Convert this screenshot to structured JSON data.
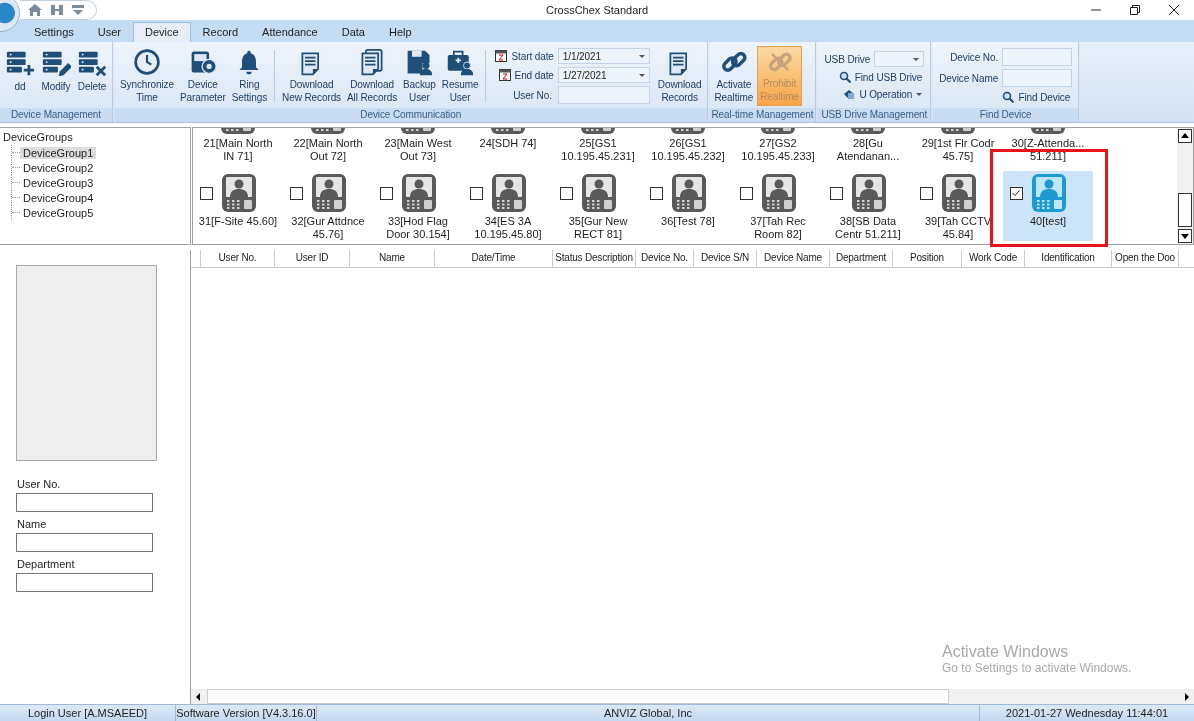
{
  "window": {
    "title": "CrossChex Standard"
  },
  "menu_tabs": [
    {
      "label": "Settings",
      "selected": false
    },
    {
      "label": "User",
      "selected": false
    },
    {
      "label": "Device",
      "selected": true
    },
    {
      "label": "Record",
      "selected": false
    },
    {
      "label": "Attendance",
      "selected": false
    },
    {
      "label": "Data",
      "selected": false
    },
    {
      "label": "Help",
      "selected": false
    }
  ],
  "device_management": {
    "title": "Device Management",
    "buttons": [
      {
        "label": "dd"
      },
      {
        "label": "Modify"
      },
      {
        "label": "Delete"
      }
    ]
  },
  "device_communication": {
    "title": "Device Communication",
    "buttons_a": [
      {
        "label": "Synchronize\nTime"
      },
      {
        "label": "Device\nParameter"
      },
      {
        "label": "Ring\nSettings"
      }
    ],
    "buttons_b": [
      {
        "label": "Download\nNew Records"
      },
      {
        "label": "Download\nAll Records"
      },
      {
        "label": "Backup\nUser"
      },
      {
        "label": "Resume\nUser"
      }
    ],
    "start_date": {
      "label": "Start date",
      "value": "1/1/2021"
    },
    "end_date": {
      "label": "End date",
      "value": "1/27/2021"
    },
    "user_no": {
      "label": "User No."
    },
    "download_button": {
      "label": "Download\nRecords"
    }
  },
  "realtime": {
    "title": "Real-time Management",
    "buttons": [
      {
        "label": "Activate\nRealtime",
        "highlighted": false
      },
      {
        "label": "Prohibit\nRealtime",
        "highlighted": true
      }
    ]
  },
  "usb": {
    "title": "USB Drive Management",
    "drive_label": "USB Drive",
    "find_button": "Find USB Drive",
    "operation_button": "U Operation"
  },
  "find_device": {
    "title": "Find Device",
    "device_no_label": "Device No.",
    "device_name_label": "Device Name",
    "find_button": "Find Device"
  },
  "device_tree": {
    "label": "DeviceGroups",
    "children": [
      {
        "label": "DeviceGroup1",
        "selected": true
      },
      {
        "label": "DeviceGroup2",
        "selected": false
      },
      {
        "label": "DeviceGroup3",
        "selected": false
      },
      {
        "label": "DeviceGroup4",
        "selected": false
      },
      {
        "label": "DeviceGroup5",
        "selected": false
      }
    ]
  },
  "devices_top_row": [
    {
      "label": "21[Main North\nIN 71]"
    },
    {
      "label": "22[Main North\nOut 72]"
    },
    {
      "label": "23[Main West\nOut 73]"
    },
    {
      "label": "24[SDH 74]"
    },
    {
      "label": "25[GS1\n10.195.45.231]"
    },
    {
      "label": "26[GS1\n10.195.45.232]"
    },
    {
      "label": "27[GS2\n10.195.45.233]"
    },
    {
      "label": "28[Gu\nAtendanan..."
    },
    {
      "label": "29[1st Flr Codr\n45.75]"
    },
    {
      "label": "30[Z-Attenda...\n51.211]"
    }
  ],
  "devices": [
    {
      "label": "31[F-Site 45.60]",
      "checked": false,
      "selected": false,
      "framed": false
    },
    {
      "label": "32[Gur Attdnce\n45.76]",
      "checked": false,
      "selected": false,
      "framed": false
    },
    {
      "label": "33[Hod Flag\nDoor 30.154]",
      "checked": false,
      "selected": false,
      "framed": false
    },
    {
      "label": "34[ES 3A\n10.195.45.80]",
      "checked": false,
      "selected": false,
      "framed": false
    },
    {
      "label": "35[Gur New\nRECT 81]",
      "checked": false,
      "selected": false,
      "framed": false
    },
    {
      "label": "36[Test 78]",
      "checked": false,
      "selected": false,
      "framed": false
    },
    {
      "label": "37[Tah Rec\nRoom 82]",
      "checked": false,
      "selected": false,
      "framed": false
    },
    {
      "label": "38[SB Data\nCentr 51.211]",
      "checked": false,
      "selected": false,
      "framed": false
    },
    {
      "label": "39[Tah CCTV\n45.84]",
      "checked": false,
      "selected": false,
      "framed": false
    },
    {
      "label": "40[test]",
      "checked": true,
      "selected": true,
      "framed": true
    }
  ],
  "user_panel": {
    "fields": [
      {
        "label": "User No."
      },
      {
        "label": "Name"
      },
      {
        "label": "Department"
      }
    ]
  },
  "records_table": {
    "columns": [
      "User No.",
      "User ID",
      "Name",
      "Date/Time",
      "Status Description",
      "Device No.",
      "Device S/N",
      "Device Name",
      "Department",
      "Position",
      "Work Code",
      "Identification",
      "Open the Doo"
    ]
  },
  "os_notice": {
    "title": "Activate Windows",
    "text": "Go to Settings to activate Windows."
  },
  "status_bar": [
    "Login User [A.MSAEED]",
    "Software Version [V4.3.16.0]",
    "ANVIZ Global, Inc",
    "2021-01-27 Wednesday 11:44:01"
  ]
}
